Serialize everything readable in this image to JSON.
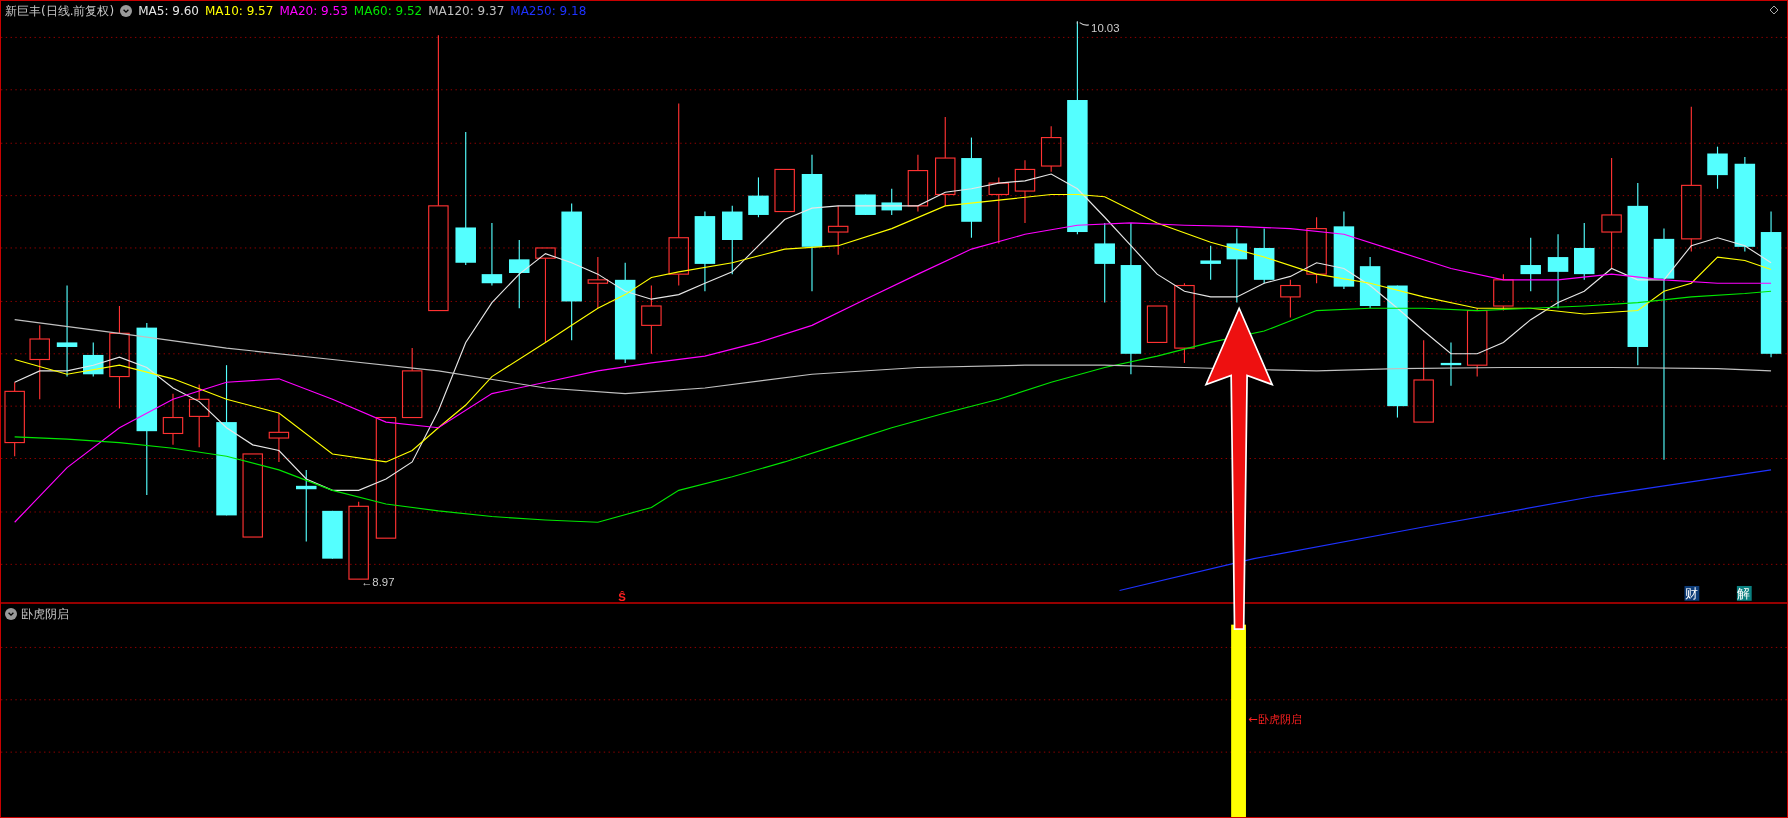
{
  "title": {
    "name": "新巨丰",
    "period": "(日线.前复权)"
  },
  "moving_averages": [
    {
      "label": "MA5: 9.60",
      "color": "#e6e6e6"
    },
    {
      "label": "MA10: 9.57",
      "color": "#ffff00"
    },
    {
      "label": "MA20: 9.53",
      "color": "#ff00ff"
    },
    {
      "label": "MA60: 9.52",
      "color": "#00e600"
    },
    {
      "label": "MA120: 9.37",
      "color": "#c0c0c0"
    },
    {
      "label": "MA250: 9.18",
      "color": "#1e32ff"
    }
  ],
  "price_markers": [
    {
      "kind": "high",
      "label": "10.03"
    },
    {
      "kind": "low",
      "label": "←8.97"
    }
  ],
  "signal_mark": "Ŝ",
  "badges": [
    {
      "label": "财",
      "color": "#0d3c78"
    },
    {
      "label": "解",
      "color": "#0a8080"
    }
  ],
  "indicator": {
    "name": "卧虎阴启",
    "signal_label": "←卧虎阴启"
  }
}
